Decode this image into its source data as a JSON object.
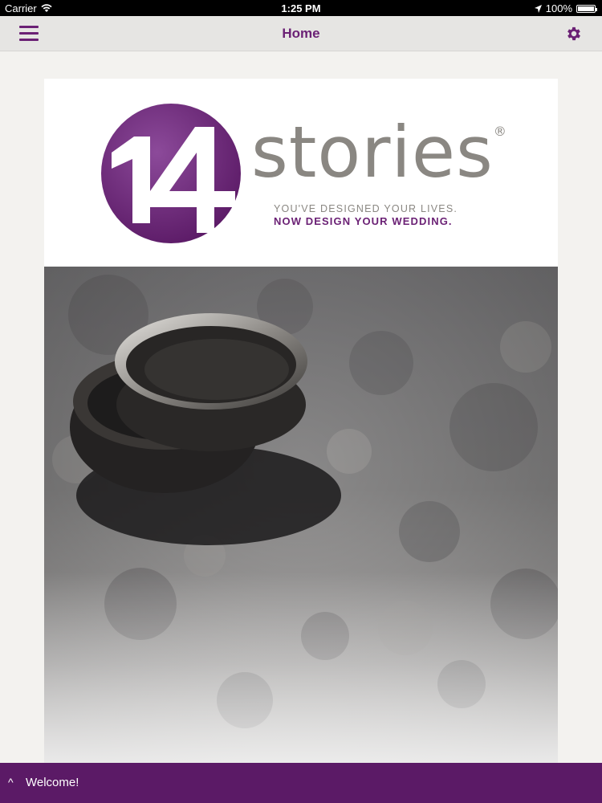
{
  "status_bar": {
    "carrier": "Carrier",
    "time": "1:25 PM",
    "battery": "100%",
    "battery_level": 1.0
  },
  "nav": {
    "title": "Home",
    "menu_icon": "hamburger-menu-icon",
    "settings_icon": "gear-icon"
  },
  "logo": {
    "number": "14",
    "wordmark": "stories",
    "registered": "®",
    "tagline_line1": "YOU'VE DESIGNED YOUR LIVES.",
    "tagline_line2": "NOW DESIGN YOUR WEDDING."
  },
  "bottom_bar": {
    "chevron": "^",
    "label": "Welcome!"
  },
  "colors": {
    "brand_purple": "#6b2175",
    "bottom_bar": "#5b1a66",
    "wordmark_gray": "#8a8782",
    "background": "#f3f2ef"
  }
}
